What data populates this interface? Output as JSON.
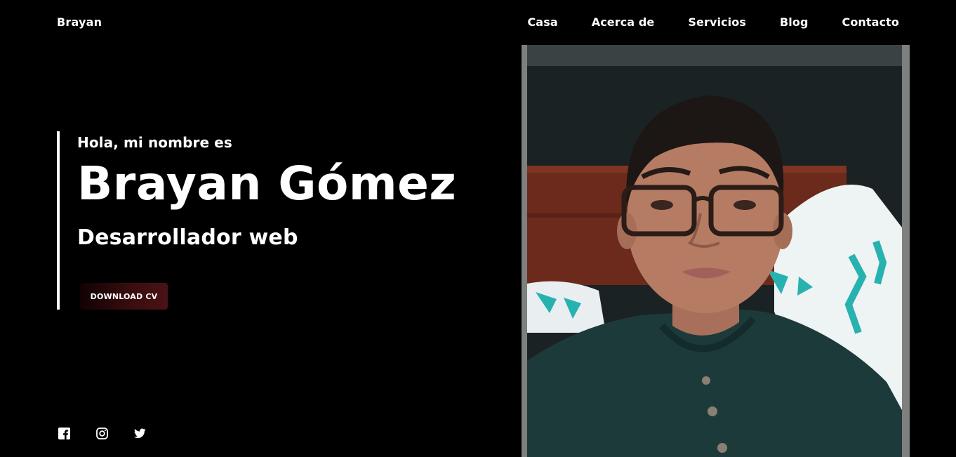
{
  "header": {
    "brand": "Brayan",
    "nav": [
      "Casa",
      "Acerca de",
      "Servicios",
      "Blog",
      "Contacto"
    ]
  },
  "hero": {
    "greeting": "Hola, mi nombre es",
    "name": "Brayan Gómez",
    "role": "Desarrollador web",
    "cv_button": "DOWNLOAD CV"
  },
  "social": {
    "icons": [
      "facebook-icon",
      "instagram-icon",
      "twitter-icon"
    ]
  },
  "colors": {
    "background": "#000000",
    "text": "#ffffff",
    "button_accent": "#4a1216"
  }
}
